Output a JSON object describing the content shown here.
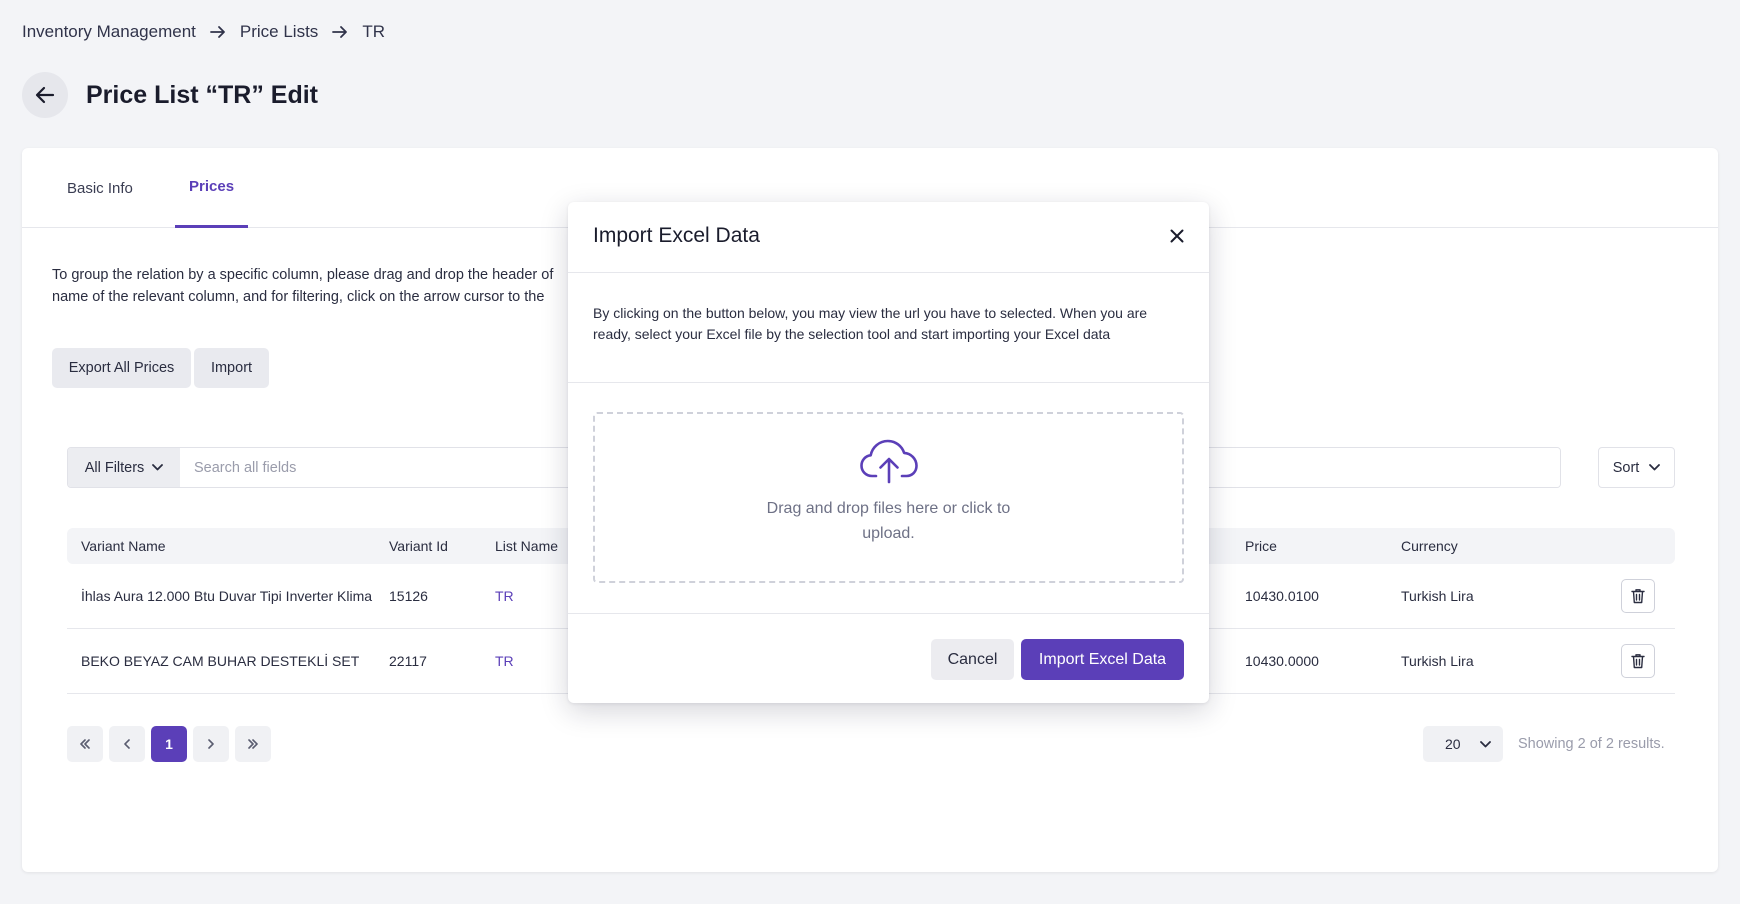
{
  "breadcrumb": {
    "items": [
      "Inventory Management",
      "Price Lists",
      "TR"
    ]
  },
  "page": {
    "title": "Price List “TR” Edit"
  },
  "tabs": [
    {
      "label": "Basic Info"
    },
    {
      "label": "Prices"
    }
  ],
  "help": {
    "line1": "To group the relation by a specific column, please drag and drop the header of",
    "line2": "name of the relevant column, and for filtering, click on the arrow cursor to the"
  },
  "actions": {
    "export_label": "Export All Prices",
    "import_label": "Import"
  },
  "filters": {
    "all_filters_label": "All Filters",
    "search_placeholder": "Search all fields",
    "sort_label": "Sort"
  },
  "table": {
    "headers": {
      "variant_name": "Variant Name",
      "variant_id": "Variant Id",
      "list_name": "List Name",
      "price": "Price",
      "currency": "Currency"
    },
    "rows": [
      {
        "variant_name": "İhlas Aura 12.000 Btu Duvar Tipi Inverter Klima",
        "variant_id": "15126",
        "list_name": "TR",
        "price": "10430.0100",
        "currency": "Turkish Lira"
      },
      {
        "variant_name": "BEKO BEYAZ CAM BUHAR DESTEKLİ SET",
        "variant_id": "22117",
        "list_name": "TR",
        "price": "10430.0000",
        "currency": "Turkish Lira"
      }
    ]
  },
  "pagination": {
    "current_page": "1",
    "page_size": "20",
    "results_text": "Showing 2 of 2 results."
  },
  "modal": {
    "title": "Import Excel Data",
    "description_line1": "By clicking on the button below, you may view the url you have to selected. When you are",
    "description_line2": "ready, select your Excel file by the selection tool and start importing your Excel data",
    "dropzone_text": "Drag and drop files here or click to upload.",
    "cancel_label": "Cancel",
    "import_label": "Import Excel Data"
  },
  "colors": {
    "accent": "#5b3fb8",
    "background": "#f3f4f7"
  }
}
